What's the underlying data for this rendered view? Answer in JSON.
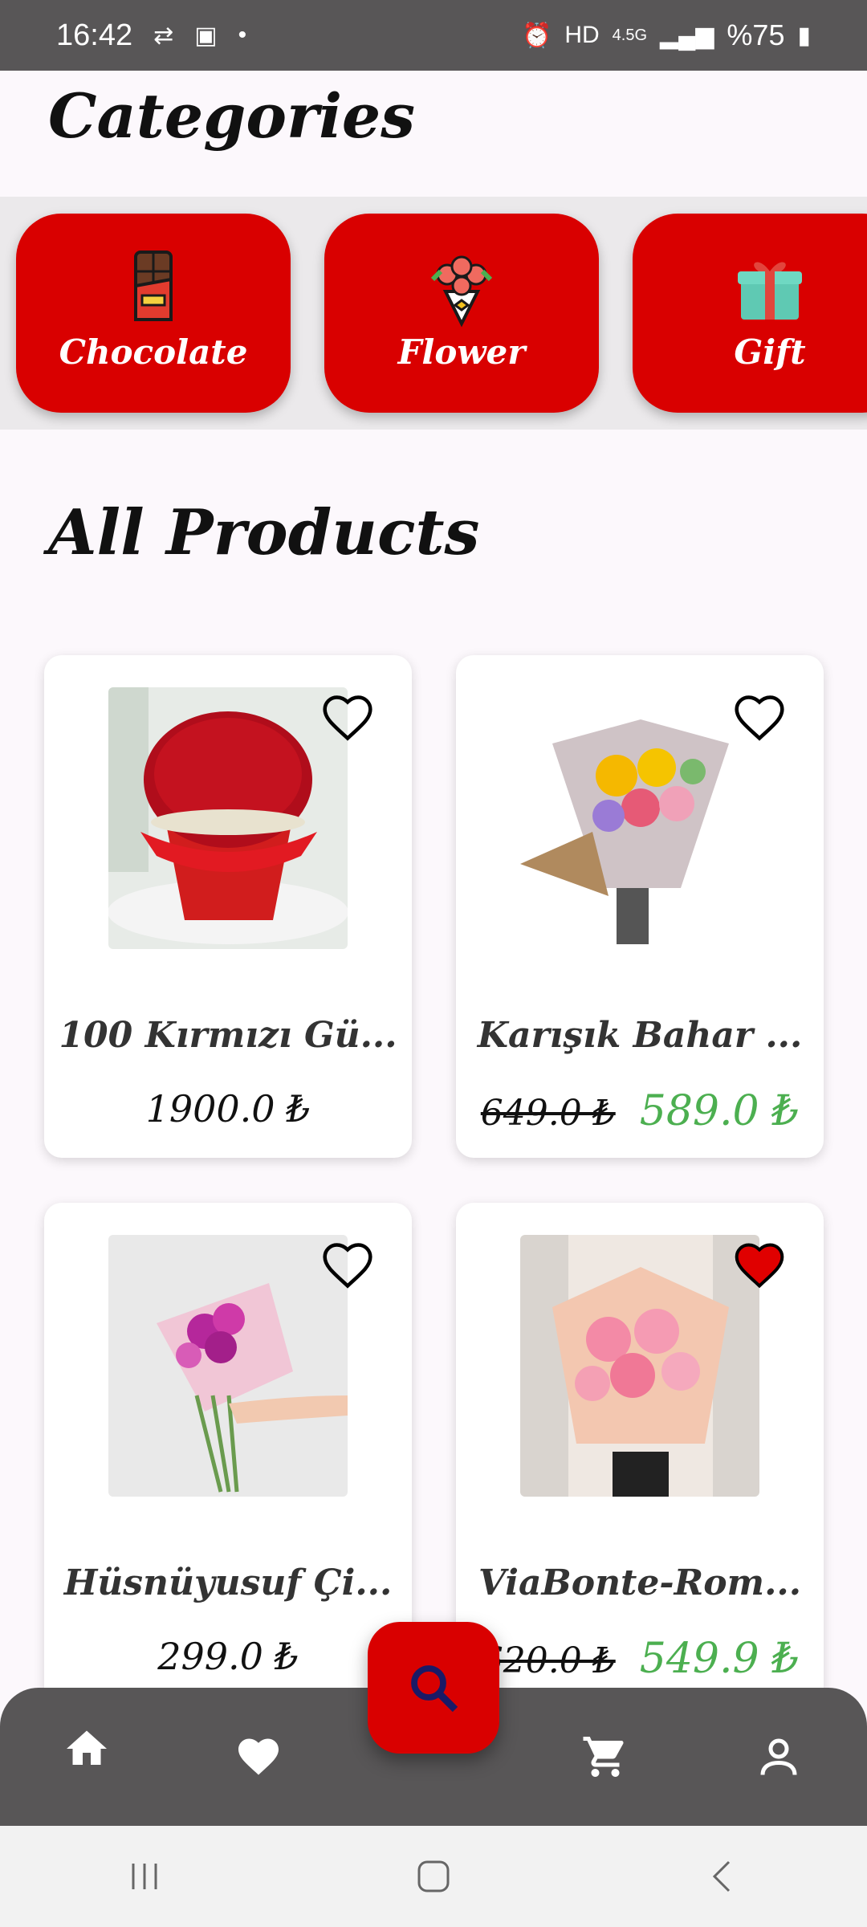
{
  "status_bar": {
    "time": "16:42",
    "battery": "%75",
    "network": "4.5G"
  },
  "categories": {
    "title": "Categories",
    "items": [
      {
        "label": "Chocolate",
        "icon": "chocolate-icon"
      },
      {
        "label": "Flower",
        "icon": "bouquet-icon"
      },
      {
        "label": "Gift",
        "icon": "gift-icon"
      }
    ]
  },
  "products": {
    "title": "All Products",
    "items": [
      {
        "name": "100 Kırmızı Gü...",
        "price": "1900.0 ₺",
        "favorite": false
      },
      {
        "name": "Karışık Bahar ...",
        "old_price": "649.0 ₺",
        "new_price": "589.0 ₺",
        "favorite": false
      },
      {
        "name": "Hüsnüyusuf Çi...",
        "price": "299.0 ₺",
        "favorite": false
      },
      {
        "name": "ViaBonte-Rom...",
        "old_price": "620.0 ₺",
        "new_price": "549.9 ₺",
        "favorite": true
      }
    ]
  },
  "bottom_nav": [
    "home-icon",
    "heart-icon",
    "search-icon",
    "cart-icon",
    "profile-icon"
  ],
  "colors": {
    "accent": "#d90000",
    "nav": "#585657",
    "sale": "#4caf50"
  }
}
